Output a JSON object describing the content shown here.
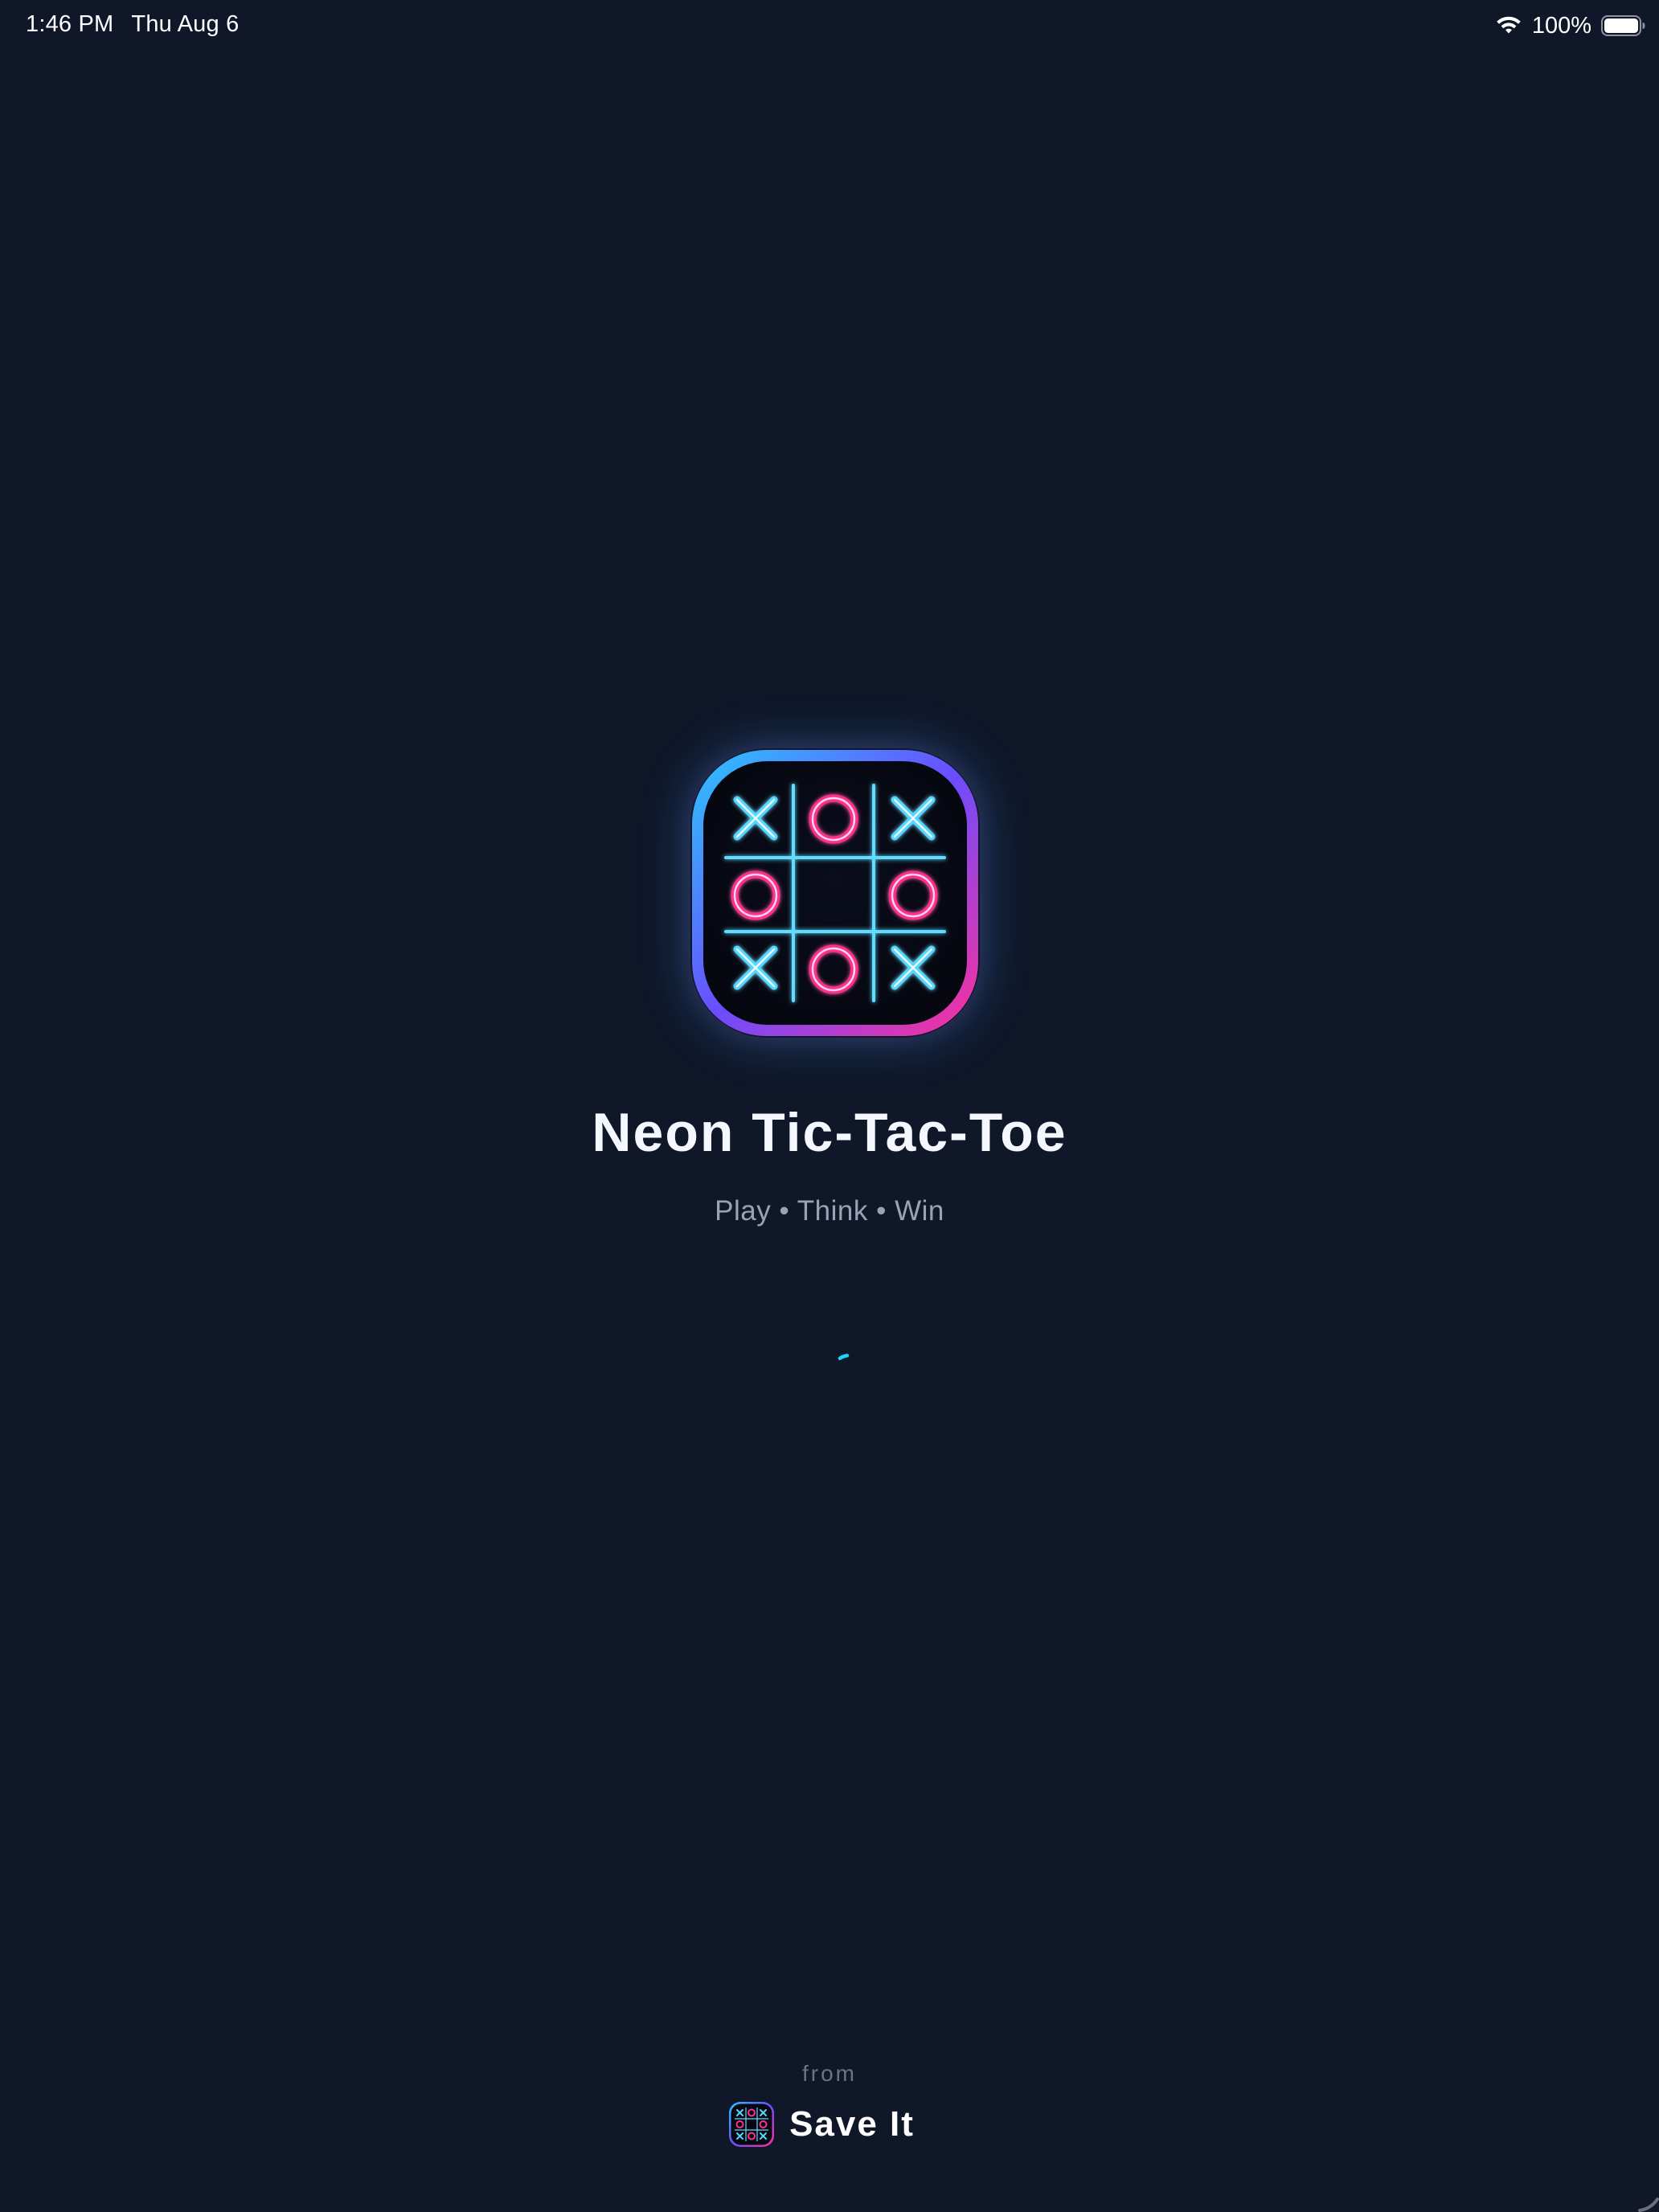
{
  "status_bar": {
    "time": "1:46 PM",
    "date": "Thu Aug 6",
    "battery_percent": "100%",
    "wifi_icon": "wifi-icon",
    "battery_icon": "battery-full-icon"
  },
  "splash": {
    "app_icon": "tic-tac-toe-neon-icon",
    "title": "Neon Tic-Tac-Toe",
    "tagline": "Play • Think • Win",
    "loading_indicator": "spinner-icon"
  },
  "footer": {
    "from_label": "from",
    "publisher_logo": "tic-tac-toe-logo-icon",
    "publisher_name": "Save It"
  },
  "colors": {
    "background": "#101729",
    "neon_cyan": "#2fd0ff",
    "neon_pink": "#ff2f8f",
    "title": "#f5f7ff",
    "tagline": "#9aa3b5",
    "from": "#6b7385"
  }
}
